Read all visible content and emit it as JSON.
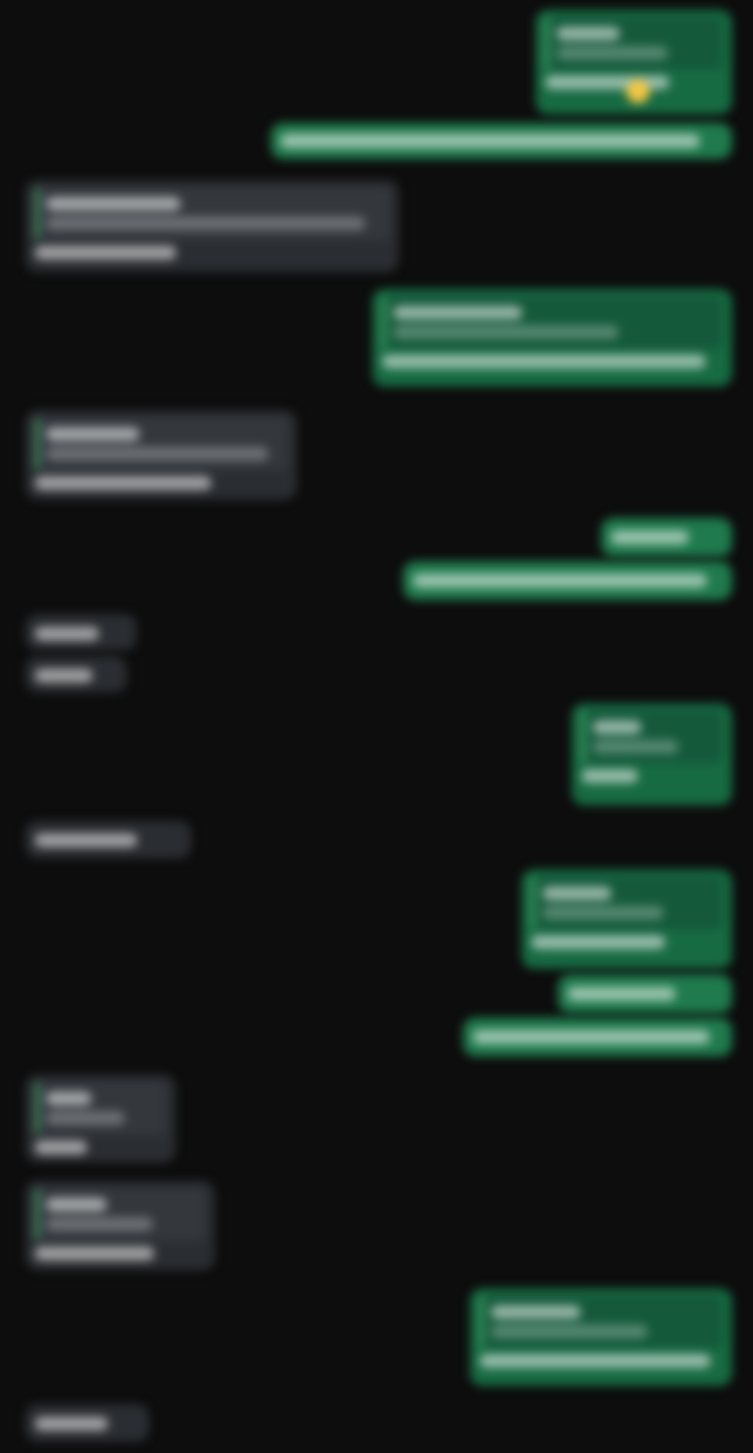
{
  "conversation": {
    "messages": [
      {
        "direction": "outgoing",
        "has_quote": true,
        "has_emoji": true
      },
      {
        "direction": "outgoing",
        "has_quote": false
      },
      {
        "direction": "incoming",
        "has_quote": true
      },
      {
        "direction": "outgoing",
        "has_quote": true
      },
      {
        "direction": "incoming",
        "has_quote": true
      },
      {
        "direction": "outgoing",
        "has_quote": false
      },
      {
        "direction": "outgoing",
        "has_quote": false
      },
      {
        "direction": "incoming",
        "has_quote": false
      },
      {
        "direction": "incoming",
        "has_quote": false
      },
      {
        "direction": "outgoing",
        "has_quote": true
      },
      {
        "direction": "incoming",
        "has_quote": false
      },
      {
        "direction": "outgoing",
        "has_quote": true
      },
      {
        "direction": "outgoing",
        "has_quote": false
      },
      {
        "direction": "outgoing",
        "has_quote": false
      },
      {
        "direction": "incoming",
        "has_quote": true
      },
      {
        "direction": "incoming",
        "has_quote": true
      },
      {
        "direction": "outgoing",
        "has_quote": true
      },
      {
        "direction": "incoming",
        "has_quote": false
      }
    ],
    "note": ""
  },
  "colors": {
    "background": "#0d0d0d",
    "outgoing_bubble": "#176b43",
    "incoming_bubble": "#2a2d31",
    "quote_bar": "#3f9a62",
    "emoji": "#f2c744"
  }
}
